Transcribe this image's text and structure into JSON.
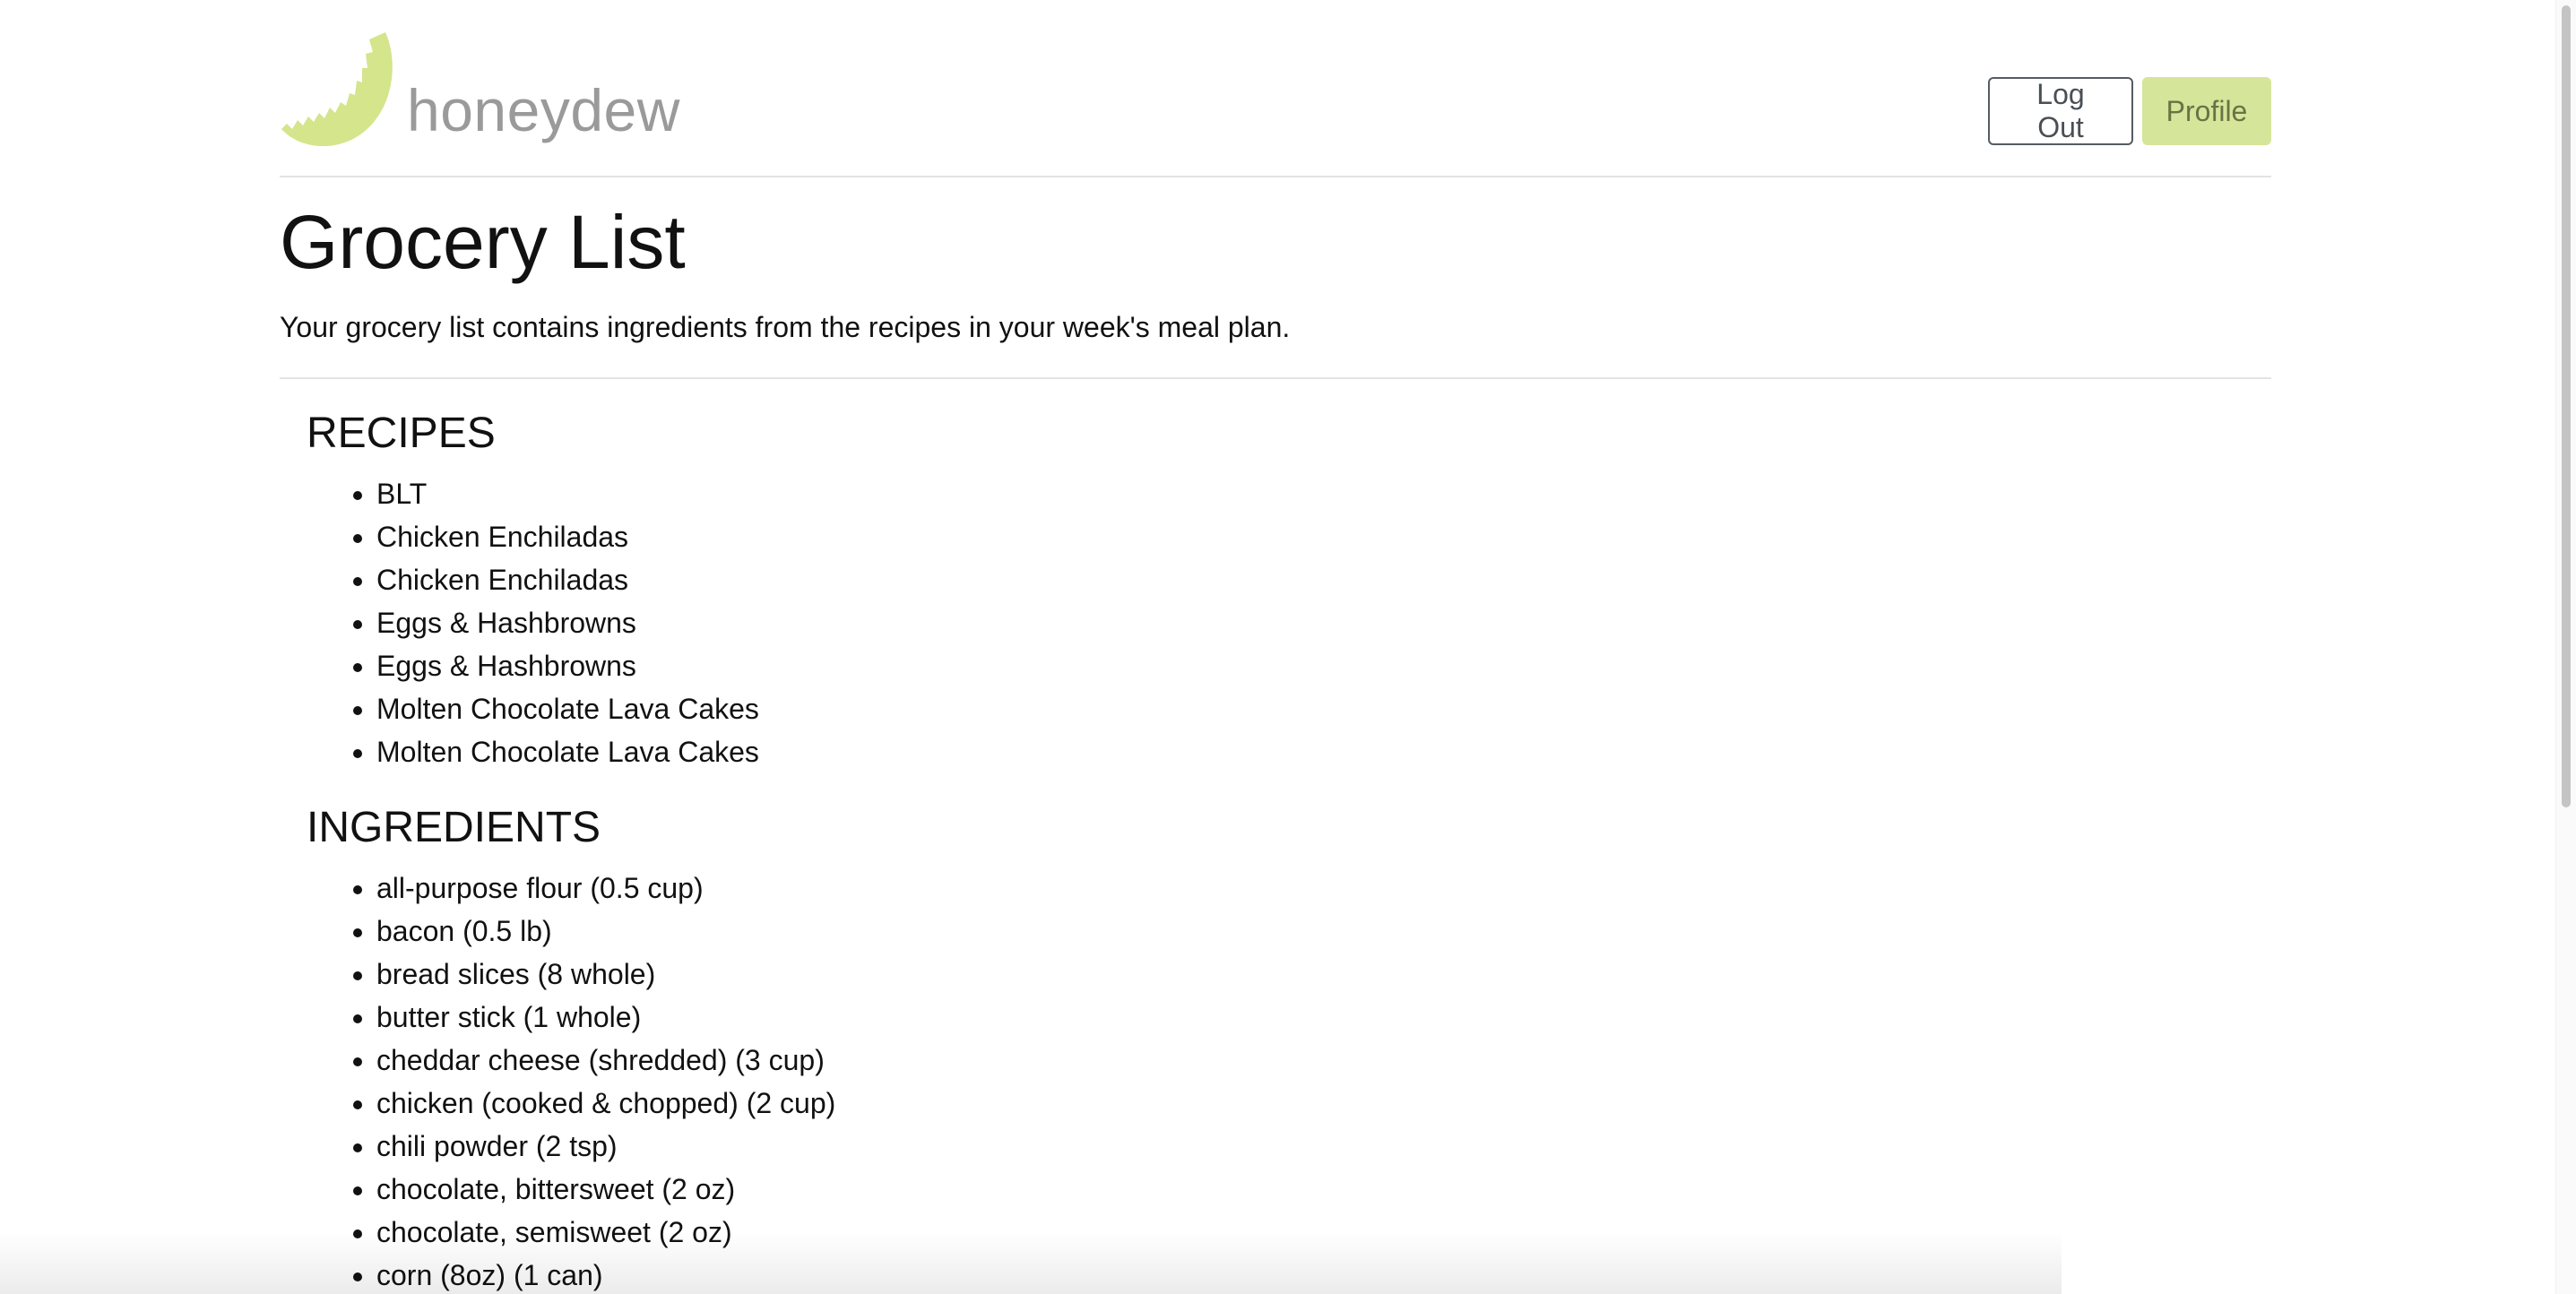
{
  "brand": {
    "name": "honeydew",
    "logo_icon": "honeydew-melon-icon",
    "logo_color": "#d4e58b",
    "name_color": "#9a9a9a"
  },
  "nav": {
    "logout_label": "Log Out",
    "profile_label": "Profile",
    "profile_color": "#d5e59a"
  },
  "page": {
    "title": "Grocery List",
    "description": "Your grocery list contains ingredients from the recipes in your week's meal plan."
  },
  "recipes": {
    "heading": "RECIPES",
    "items": [
      "BLT",
      "Chicken Enchiladas",
      "Chicken Enchiladas",
      "Eggs & Hashbrowns",
      "Eggs & Hashbrowns",
      "Molten Chocolate Lava Cakes",
      "Molten Chocolate Lava Cakes"
    ]
  },
  "ingredients": {
    "heading": "INGREDIENTS",
    "items": [
      "all-purpose flour (0.5 cup)",
      "bacon (0.5 lb)",
      "bread slices (8 whole)",
      "butter stick (1 whole)",
      "cheddar cheese (shredded) (3 cup)",
      "chicken (cooked & chopped) (2 cup)",
      "chili powder (2 tsp)",
      "chocolate, bittersweet (2 oz)",
      "chocolate, semisweet (2 oz)",
      "corn (8oz) (1 can)"
    ]
  }
}
